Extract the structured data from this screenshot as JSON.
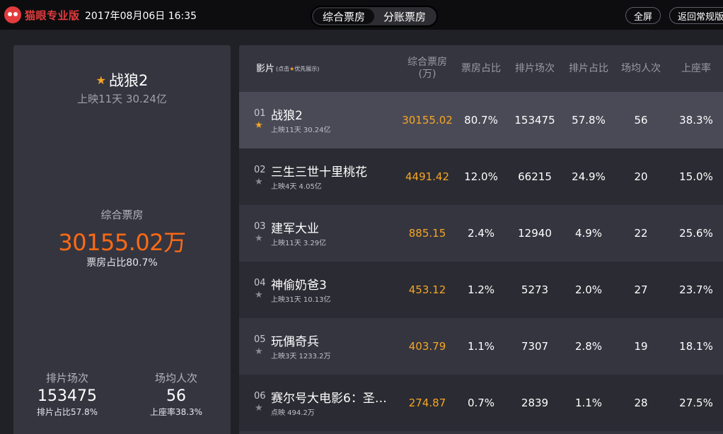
{
  "header": {
    "brand": "猫眼专业版",
    "datetime": "2017年08月06日 16:35",
    "tabs": [
      "综合票房",
      "分账票房"
    ],
    "active_tab": 0,
    "fullscreen_label": "全屏",
    "back_label": "返回常规版"
  },
  "summary": {
    "title": "战狼2",
    "subtitle": "上映11天 30.24亿",
    "box_label": "综合票房",
    "box_value": "30155.02万",
    "box_ratio": "票房占比80.7%",
    "stat1": {
      "label": "排片场次",
      "value": "153475",
      "sub": "排片占比57.8%"
    },
    "stat2": {
      "label": "场均人次",
      "value": "56",
      "sub": "上座率38.3%"
    }
  },
  "table": {
    "headers": {
      "film": "影片",
      "film_hint_pre": "(点击",
      "film_hint_post": "优先展示)",
      "box_l1": "综合票房",
      "box_l2": "(万)",
      "box_share": "票房占比",
      "shows": "排片场次",
      "show_share": "排片占比",
      "avg_viewers": "场均人次",
      "occupancy": "上座率"
    },
    "rows": [
      {
        "rank": "01",
        "name": "战狼2",
        "info": "上映11天  30.24亿",
        "box": "30155.02",
        "box_share": "80.7%",
        "shows": "153475",
        "show_share": "57.8%",
        "avg": "56",
        "occ": "38.3%"
      },
      {
        "rank": "02",
        "name": "三生三世十里桃花",
        "info": "上映4天  4.05亿",
        "box": "4491.42",
        "box_share": "12.0%",
        "shows": "66215",
        "show_share": "24.9%",
        "avg": "20",
        "occ": "15.0%"
      },
      {
        "rank": "03",
        "name": "建军大业",
        "info": "上映11天  3.29亿",
        "box": "885.15",
        "box_share": "2.4%",
        "shows": "12940",
        "show_share": "4.9%",
        "avg": "22",
        "occ": "25.6%"
      },
      {
        "rank": "04",
        "name": "神偷奶爸3",
        "info": "上映31天  10.13亿",
        "box": "453.12",
        "box_share": "1.2%",
        "shows": "5273",
        "show_share": "2.0%",
        "avg": "27",
        "occ": "23.7%"
      },
      {
        "rank": "05",
        "name": "玩偶奇兵",
        "info": "上映3天  1233.2万",
        "box": "403.79",
        "box_share": "1.1%",
        "shows": "7307",
        "show_share": "2.8%",
        "avg": "19",
        "occ": "18.1%"
      },
      {
        "rank": "06",
        "name": "赛尔号大电影6：圣…",
        "info": "点映  494.2万",
        "box": "274.87",
        "box_share": "0.7%",
        "shows": "2839",
        "show_share": "1.1%",
        "avg": "28",
        "occ": "27.5%"
      }
    ]
  },
  "colors": {
    "accent_orange": "#ff6a13",
    "box_office_yellow": "#f5a623",
    "brand_red": "#e23c3c"
  }
}
